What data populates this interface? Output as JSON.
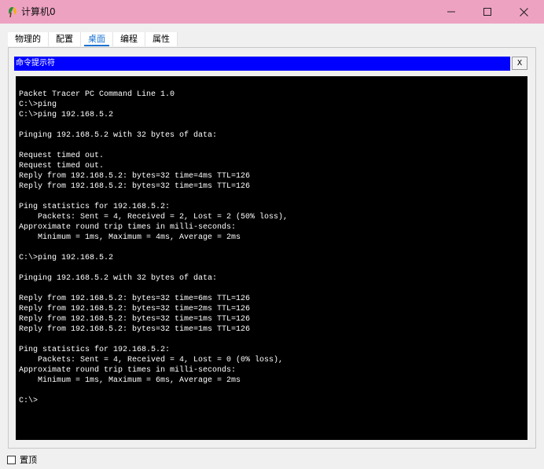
{
  "window": {
    "title": "计算机0",
    "minimize_glyph": "—",
    "maximize_glyph": "☐",
    "close_glyph": "✕"
  },
  "tabs": [
    {
      "label": "物理的"
    },
    {
      "label": "配置"
    },
    {
      "label": "桌面",
      "active": true
    },
    {
      "label": "编程"
    },
    {
      "label": "属性"
    }
  ],
  "command_prompt": {
    "title": "命令提示符",
    "close_label": "X",
    "lines": [
      "Packet Tracer PC Command Line 1.0",
      "C:\\>ping",
      "C:\\>ping 192.168.5.2",
      "",
      "Pinging 192.168.5.2 with 32 bytes of data:",
      "",
      "Request timed out.",
      "Request timed out.",
      "Reply from 192.168.5.2: bytes=32 time=4ms TTL=126",
      "Reply from 192.168.5.2: bytes=32 time=1ms TTL=126",
      "",
      "Ping statistics for 192.168.5.2:",
      "    Packets: Sent = 4, Received = 2, Lost = 2 (50% loss),",
      "Approximate round trip times in milli-seconds:",
      "    Minimum = 1ms, Maximum = 4ms, Average = 2ms",
      "",
      "C:\\>ping 192.168.5.2",
      "",
      "Pinging 192.168.5.2 with 32 bytes of data:",
      "",
      "Reply from 192.168.5.2: bytes=32 time=6ms TTL=126",
      "Reply from 192.168.5.2: bytes=32 time=2ms TTL=126",
      "Reply from 192.168.5.2: bytes=32 time=1ms TTL=126",
      "Reply from 192.168.5.2: bytes=32 time=1ms TTL=126",
      "",
      "Ping statistics for 192.168.5.2:",
      "    Packets: Sent = 4, Received = 4, Lost = 0 (0% loss),",
      "Approximate round trip times in milli-seconds:",
      "    Minimum = 1ms, Maximum = 6ms, Average = 2ms",
      "",
      "C:\\>"
    ]
  },
  "footer": {
    "always_on_top_label": "置顶",
    "always_on_top_checked": false
  },
  "colors": {
    "titlebar": "#eea2c2",
    "cmd_titlebar": "#0000ff",
    "terminal_bg": "#000000",
    "terminal_fg": "#ffffff",
    "active_tab": "#1a73d0"
  },
  "icons": {
    "app": "pc-leaf-icon",
    "minimize": "minimize-icon",
    "maximize": "maximize-icon",
    "close": "close-icon"
  }
}
